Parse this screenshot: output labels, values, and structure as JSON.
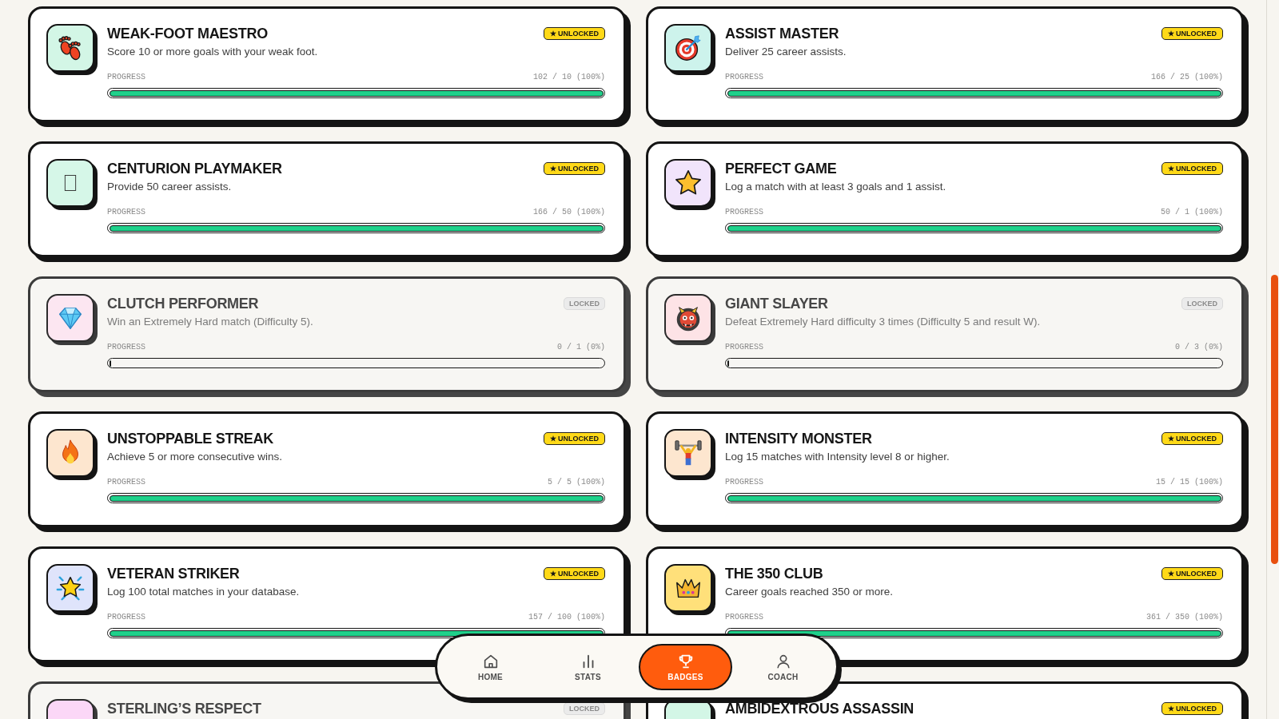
{
  "achievements": [
    {
      "title": "WEAK-FOOT MAESTRO",
      "description": "Score 10 or more goals with your weak foot.",
      "unlocked": true,
      "status": "★ UNLOCKED",
      "color": "#d3f6e6",
      "progress_label": "PROGRESS",
      "reading": "102 / 10 (100%)",
      "level": 1
    },
    {
      "title": "ASSIST MASTER",
      "description": "Deliver 25 career assists.",
      "unlocked": true,
      "status": "★ UNLOCKED",
      "color": "#cdf3ec",
      "progress_label": "PROGRESS",
      "reading": "166 / 25 (100%)",
      "level": 1
    },
    {
      "title": "CENTURION PLAYMAKER",
      "description": "Provide 50 career assists.",
      "unlocked": true,
      "status": "★ UNLOCKED",
      "color": "#d6f7e8",
      "progress_label": "PROGRESS",
      "reading": "166 / 50 (100%)",
      "level": 1
    },
    {
      "title": "PERFECT GAME",
      "description": "Log a match with at least 3 goals and 1 assist.",
      "unlocked": true,
      "status": "★ UNLOCKED",
      "color": "#f1e4fb",
      "progress_label": "PROGRESS",
      "reading": "50 / 1 (100%)",
      "level": 1
    },
    {
      "title": "CLUTCH PERFORMER",
      "description": "Win an Extremely Hard match (Difficulty 5).",
      "unlocked": false,
      "status": "LOCKED",
      "color": "#fce6f1",
      "progress_label": "PROGRESS",
      "reading": "0 / 1 (0%)",
      "level": 0
    },
    {
      "title": "GIANT SLAYER",
      "description": "Defeat Extremely Hard difficulty 3 times (Difficulty 5 and result W).",
      "unlocked": false,
      "status": "LOCKED",
      "color": "#fde3e6",
      "progress_label": "PROGRESS",
      "reading": "0 / 3 (0%)",
      "level": 0
    },
    {
      "title": "UNSTOPPABLE STREAK",
      "description": "Achieve 5 or more consecutive wins.",
      "unlocked": true,
      "status": "★ UNLOCKED",
      "color": "#fde6cf",
      "progress_label": "PROGRESS",
      "reading": "5 / 5 (100%)",
      "level": 1
    },
    {
      "title": "INTENSITY MONSTER",
      "description": "Log 15 matches with Intensity level 8 or higher.",
      "unlocked": true,
      "status": "★ UNLOCKED",
      "color": "#fde6cf",
      "progress_label": "PROGRESS",
      "reading": "15 / 15 (100%)",
      "level": 1
    },
    {
      "title": "VETERAN STRIKER",
      "description": "Log 100 total matches in your database.",
      "unlocked": true,
      "status": "★ UNLOCKED",
      "color": "#dfe4fb",
      "progress_label": "PROGRESS",
      "reading": "157 / 100 (100%)",
      "level": 1
    },
    {
      "title": "THE 350 CLUB",
      "description": "Career goals reached 350 or more.",
      "unlocked": true,
      "status": "★ UNLOCKED",
      "color": "#ffe07a",
      "progress_label": "PROGRESS",
      "reading": "361 / 350 (100%)",
      "level": 1
    },
    {
      "title": "STERLING’S RESPECT",
      "unlocked": false,
      "status": "LOCKED",
      "color": "#fbd7f7"
    },
    {
      "title": "AMBIDEXTROUS ASSASSIN",
      "unlocked": true,
      "status": "★ UNLOCKED",
      "color": "#d3f6e6"
    }
  ],
  "nav": [
    {
      "label": "HOME",
      "selected": false
    },
    {
      "label": "STATS",
      "selected": false
    },
    {
      "label": "BADGES",
      "selected": true
    },
    {
      "label": "COACH",
      "selected": false
    }
  ]
}
